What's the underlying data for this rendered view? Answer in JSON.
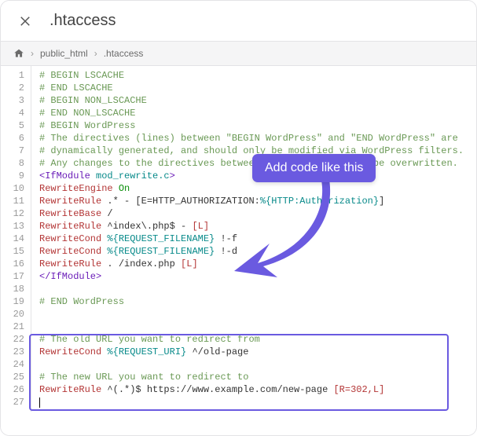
{
  "header": {
    "title": ".htaccess"
  },
  "breadcrumb": {
    "items": [
      "public_html",
      ".htaccess"
    ]
  },
  "callout": {
    "text": "Add code like this"
  },
  "code": {
    "lines": [
      [
        {
          "t": "# BEGIN LSCACHE",
          "c": "comment"
        }
      ],
      [
        {
          "t": "# END LSCACHE",
          "c": "comment"
        }
      ],
      [
        {
          "t": "# BEGIN NON_LSCACHE",
          "c": "comment"
        }
      ],
      [
        {
          "t": "# END NON_LSCACHE",
          "c": "comment"
        }
      ],
      [
        {
          "t": "# BEGIN WordPress",
          "c": "comment"
        }
      ],
      [
        {
          "t": "# The directives (lines) between \"BEGIN WordPress\" and \"END WordPress\" are",
          "c": "comment"
        }
      ],
      [
        {
          "t": "# dynamically generated, and should only be modified via WordPress filters.",
          "c": "comment"
        }
      ],
      [
        {
          "t": "# Any changes to the directives between these markers will be overwritten.",
          "c": "comment"
        }
      ],
      [
        {
          "t": "<IfModule",
          "c": "purple"
        },
        {
          "t": " ",
          "c": ""
        },
        {
          "t": "mod_rewrite.c",
          "c": "teal"
        },
        {
          "t": ">",
          "c": "purple"
        }
      ],
      [
        {
          "t": "RewriteEngine",
          "c": "red"
        },
        {
          "t": " ",
          "c": ""
        },
        {
          "t": "On",
          "c": "green"
        }
      ],
      [
        {
          "t": "RewriteRule",
          "c": "red"
        },
        {
          "t": " .* - [E=HTTP_AUTHORIZATION:",
          "c": ""
        },
        {
          "t": "%{HTTP:Authorization}",
          "c": "teal"
        },
        {
          "t": "]",
          "c": ""
        }
      ],
      [
        {
          "t": "RewriteBase",
          "c": "red"
        },
        {
          "t": " /",
          "c": ""
        }
      ],
      [
        {
          "t": "RewriteRule",
          "c": "red"
        },
        {
          "t": " ^index\\.php$ - ",
          "c": ""
        },
        {
          "t": "[L]",
          "c": "redbrack"
        }
      ],
      [
        {
          "t": "RewriteCond",
          "c": "red"
        },
        {
          "t": " ",
          "c": ""
        },
        {
          "t": "%{REQUEST_FILENAME}",
          "c": "teal"
        },
        {
          "t": " !-f",
          "c": ""
        }
      ],
      [
        {
          "t": "RewriteCond",
          "c": "red"
        },
        {
          "t": " ",
          "c": ""
        },
        {
          "t": "%{REQUEST_FILENAME}",
          "c": "teal"
        },
        {
          "t": " !-d",
          "c": ""
        }
      ],
      [
        {
          "t": "RewriteRule",
          "c": "red"
        },
        {
          "t": " . /index.php ",
          "c": ""
        },
        {
          "t": "[L]",
          "c": "redbrack"
        }
      ],
      [
        {
          "t": "</IfModule>",
          "c": "purple"
        }
      ],
      [],
      [
        {
          "t": "# END WordPress",
          "c": "comment"
        }
      ],
      [],
      [],
      [
        {
          "t": "# The old URL you want to redirect from",
          "c": "comment"
        }
      ],
      [
        {
          "t": "RewriteCond",
          "c": "red"
        },
        {
          "t": " ",
          "c": ""
        },
        {
          "t": "%{REQUEST_URI}",
          "c": "teal"
        },
        {
          "t": " ^/old-page",
          "c": ""
        }
      ],
      [],
      [
        {
          "t": "# The new URL you want to redirect to",
          "c": "comment"
        }
      ],
      [
        {
          "t": "RewriteRule",
          "c": "red"
        },
        {
          "t": " ^(.*)$ https://www.example.com/new-page ",
          "c": ""
        },
        {
          "t": "[R=302,L]",
          "c": "redbrack"
        }
      ],
      []
    ]
  }
}
